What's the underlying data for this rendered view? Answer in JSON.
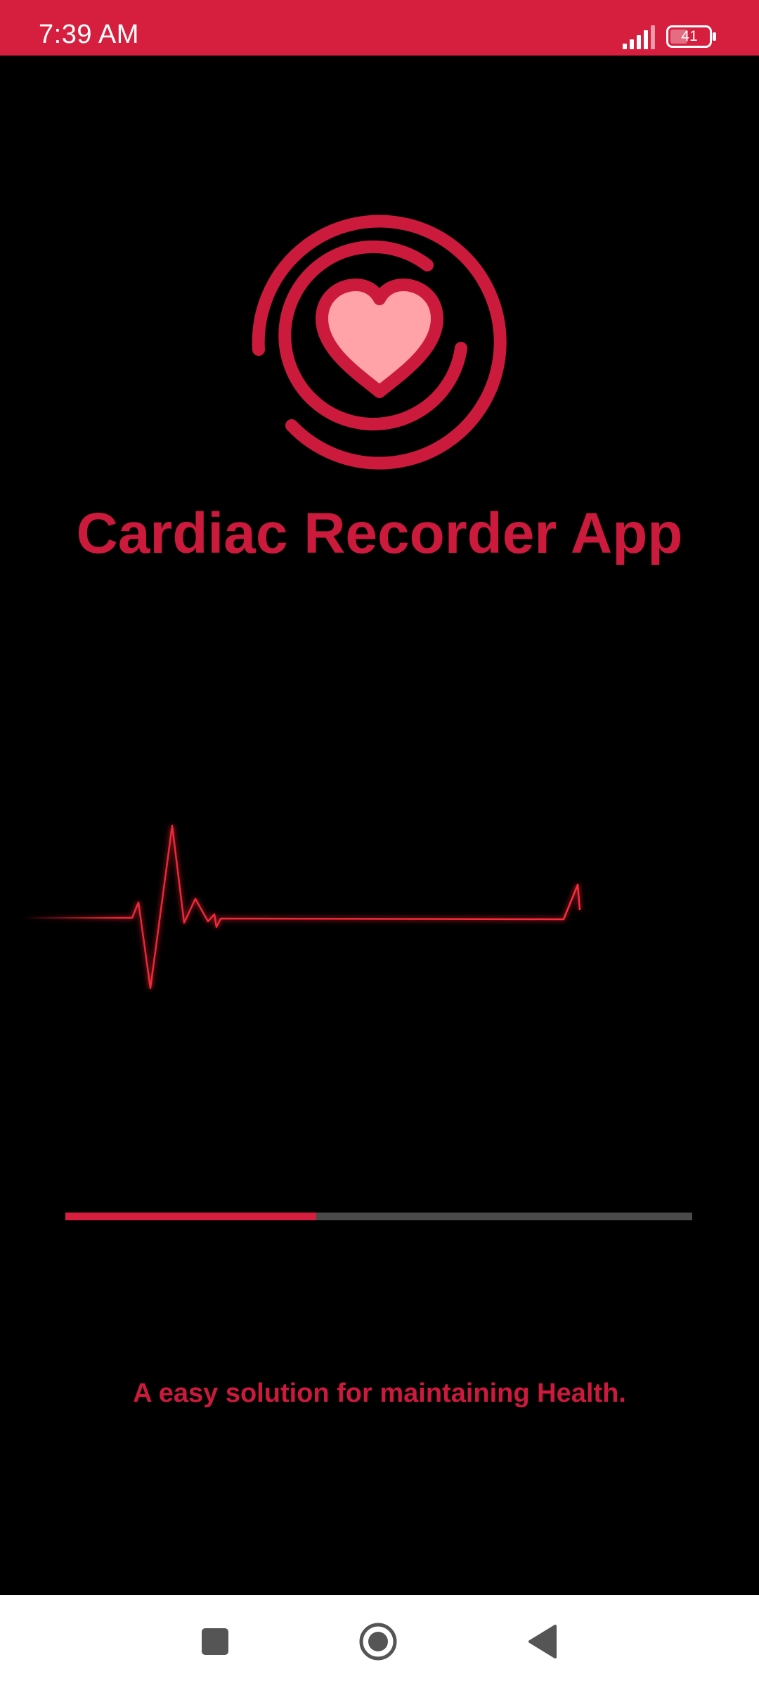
{
  "status_bar": {
    "time": "7:39 AM",
    "battery": "41",
    "icons": [
      "signal-icon",
      "battery-icon"
    ],
    "background": "#d61f3f"
  },
  "app": {
    "title": "Cardiac Recorder App",
    "tagline": "A easy solution for maintaining Health.",
    "logo_icon": "heart-circle-logo-icon",
    "accent_color": "#cc1a3d"
  },
  "ecg": {
    "icon": "ecg-waveform-icon",
    "color": "#ff2a3a"
  },
  "progress": {
    "percent": 40
  },
  "nav_bar": {
    "buttons": [
      "recents-icon",
      "home-icon",
      "back-icon"
    ]
  }
}
